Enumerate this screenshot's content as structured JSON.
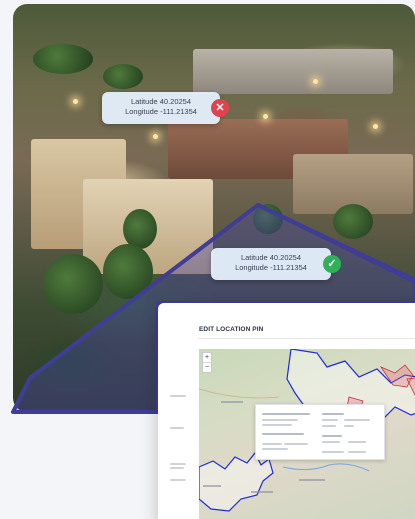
{
  "pins": [
    {
      "latitude": "Latitude 40.20254",
      "longitude": "Longitude -111.21354",
      "status": "invalid",
      "status_icon": "close-icon"
    },
    {
      "latitude": "Latitude 40.20254",
      "longitude": "Longitude -111.21354",
      "status": "valid",
      "status_icon": "check-icon"
    }
  ],
  "panel": {
    "title": "EDIT LOCATION PIN",
    "zoom_in": "+",
    "zoom_out": "−"
  },
  "colors": {
    "geofence": "#3f3d96",
    "geofence_fill": "rgba(72,68,170,0.38)",
    "invalid": "#e0434e",
    "valid": "#2fb15a",
    "map_boundary": "#1f2bd6"
  }
}
